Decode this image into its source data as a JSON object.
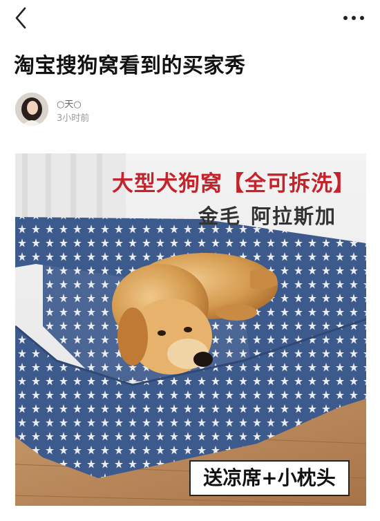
{
  "nav": {
    "back_icon": "chevron-left-icon",
    "more_icon": "more-dots-icon"
  },
  "post": {
    "title": "淘宝搜狗窝看到的买家秀",
    "author_name": "○天○",
    "time_ago": "3小时前"
  },
  "image": {
    "headline": "大型犬狗窝【全可拆洗】",
    "subline_1": "金毛",
    "subline_2": "阿拉斯加",
    "badge": "送凉席+小枕头"
  },
  "colors": {
    "headline_red": "#c4232b",
    "bed_blue": "#3d5a8c",
    "dog_gold": "#d49a4e"
  }
}
